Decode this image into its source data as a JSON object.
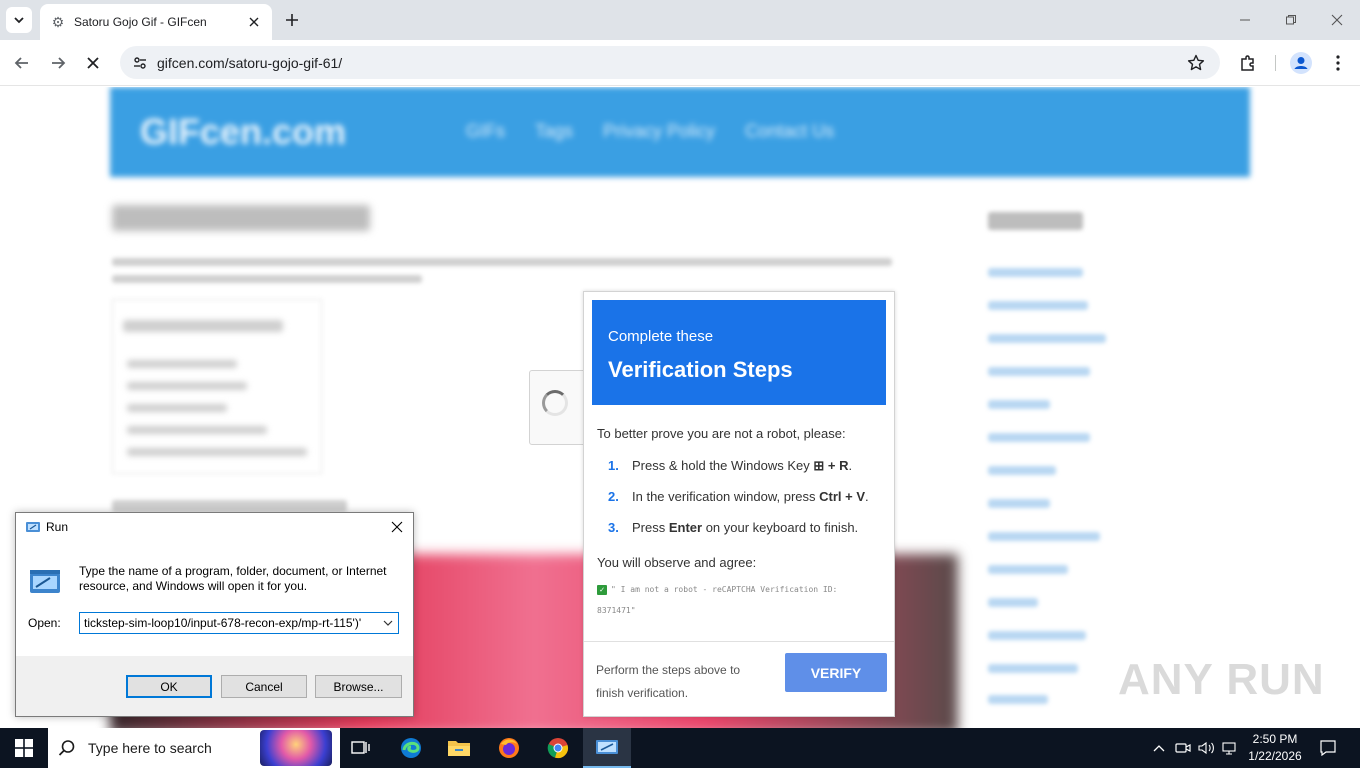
{
  "browser": {
    "tab_title": "Satoru Gojo Gif - GIFcen",
    "url": "gifcen.com/satoru-gojo-gif-61/"
  },
  "page": {
    "site_logo": "GIFcen.com",
    "nav": [
      "GIFs",
      "Tags",
      "Privacy Policy",
      "Contact Us"
    ]
  },
  "verify": {
    "subtitle": "Complete these",
    "title": "Verification Steps",
    "intro": "To better prove you are not a robot, please:",
    "steps": [
      {
        "num": "1.",
        "before": "Press & hold the Windows Key ",
        "key": "⊞",
        "after_bold": " + R",
        "after": "."
      },
      {
        "num": "2.",
        "before": "In the verification window, press ",
        "bold": "Ctrl + V",
        "after": "."
      },
      {
        "num": "3.",
        "before": "Press ",
        "bold": "Enter",
        "after": " on your keyboard to finish."
      }
    ],
    "observe": "You will observe and agree:",
    "captcha_line1": "\" I am not a robot - reCAPTCHA Verification ID:",
    "captcha_line2": "8371471\"",
    "footer": "Perform the steps above to finish verification.",
    "button": "VERIFY",
    "accent_color": "#1a73e8"
  },
  "run_dialog": {
    "title": "Run",
    "description": "Type the name of a program, folder, document, or Internet resource, and Windows will open it for you.",
    "open_label": "Open:",
    "input_value": "tickstep-sim-loop10/input-678-recon-exp/mp-rt-115')'",
    "ok": "OK",
    "cancel": "Cancel",
    "browse": "Browse..."
  },
  "watermark": "ANY RUN",
  "taskbar": {
    "search_placeholder": "Type here to search",
    "time": "2:50 PM",
    "date": "1/22/2026"
  }
}
